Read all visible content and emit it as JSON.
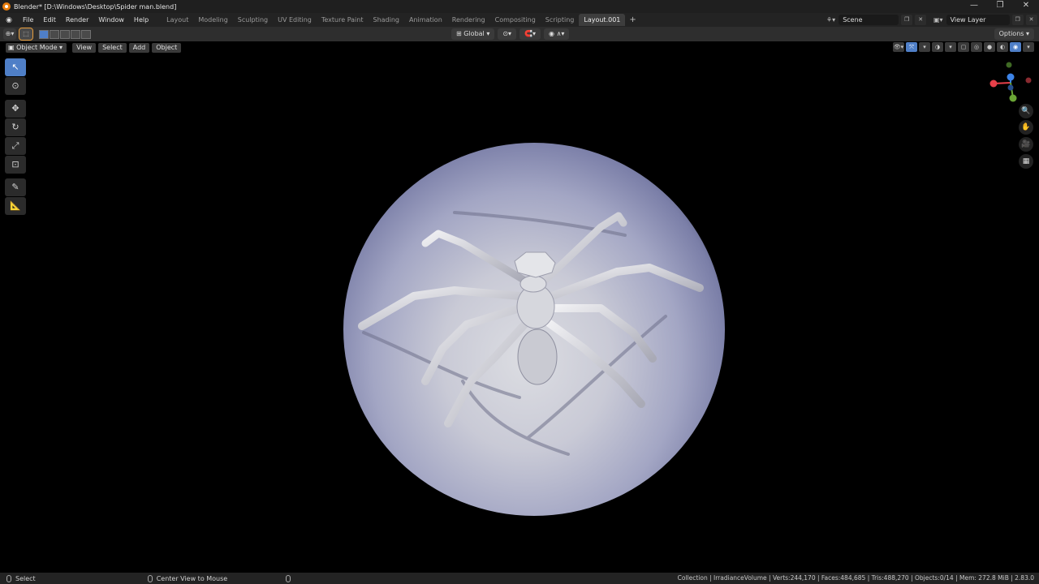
{
  "window": {
    "title": "Blender* [D:\\Windows\\Desktop\\Spider man.blend]",
    "controls": [
      "—",
      "❐",
      "✕"
    ]
  },
  "menu": [
    "File",
    "Edit",
    "Render",
    "Window",
    "Help"
  ],
  "workspaces": [
    "Layout",
    "Modeling",
    "Sculpting",
    "UV Editing",
    "Texture Paint",
    "Shading",
    "Animation",
    "Rendering",
    "Compositing",
    "Scripting",
    "Layout.001"
  ],
  "active_workspace": "Layout.001",
  "scene": {
    "label": "Scene"
  },
  "view_layer": {
    "label": "View Layer"
  },
  "tool_header": {
    "orientation": "Global",
    "options_label": "Options"
  },
  "viewport_header": {
    "mode": "Object Mode",
    "view": "View",
    "select": "Select",
    "add": "Add",
    "object": "Object"
  },
  "toolbar": {
    "tools": [
      "select-box",
      "cursor",
      "move",
      "rotate",
      "scale",
      "transform",
      "annotate",
      "measure"
    ]
  },
  "gizmo": {
    "x_label": "X",
    "y_label": "Y",
    "z_label": "Z",
    "x_color": "#e8404a",
    "y_color": "#6aa535",
    "z_color": "#3d84e8"
  },
  "status": {
    "left1": "Select",
    "left2": "Center View to Mouse",
    "stats": "Collection | IrradianceVolume | Verts:244,170 | Faces:484,685 | Tris:488,270 | Objects:0/14 | Mem: 272.8 MiB | 2.83.0"
  },
  "colors": {
    "accent_blue": "#4f7fc7",
    "accent_orange": "#e79d3c"
  }
}
